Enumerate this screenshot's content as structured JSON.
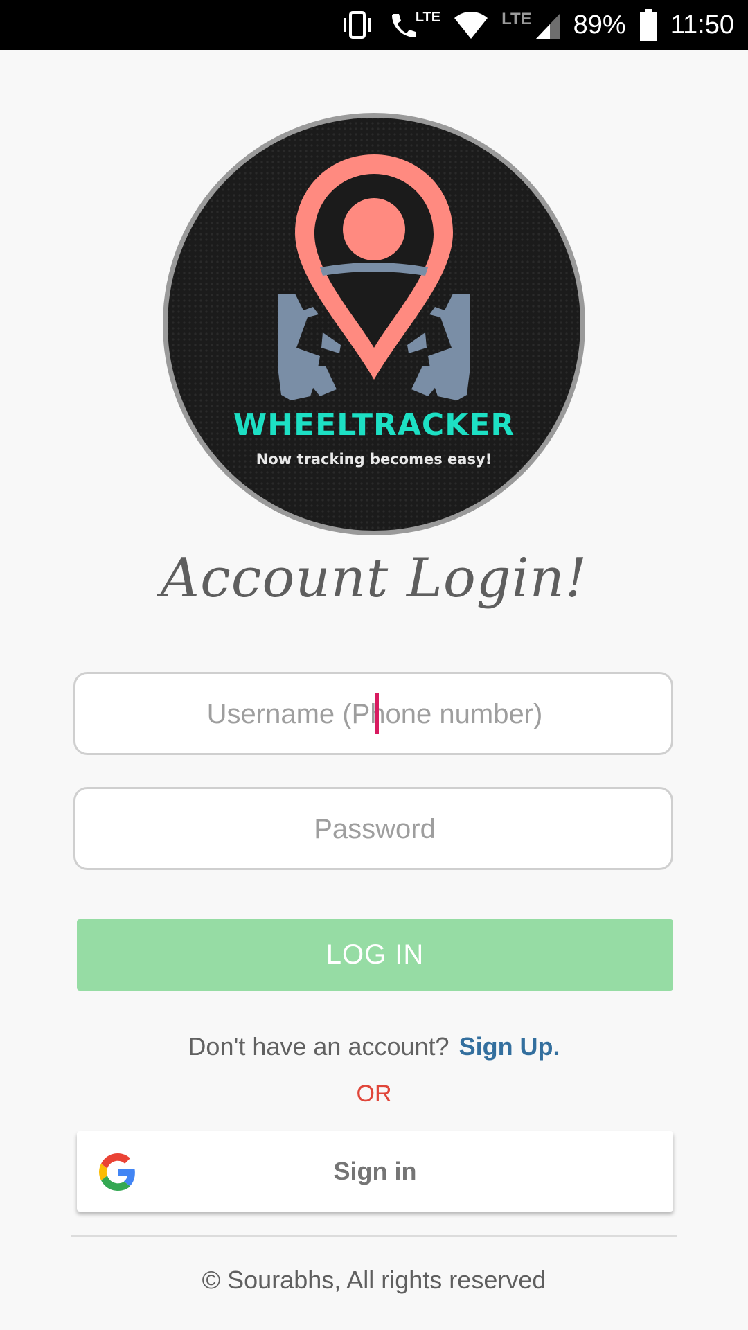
{
  "status_bar": {
    "lte_call": "LTE",
    "lte_signal": "LTE",
    "battery": "89%",
    "time": "11:50",
    "icons": [
      "vibrate-icon",
      "call-lte-icon",
      "wifi-icon",
      "signal-icon",
      "battery-icon"
    ]
  },
  "logo": {
    "brand": "WHEELTRACKER",
    "tagline": "Now tracking becomes easy!",
    "colors": {
      "pin": "#ff8a80",
      "car": "#7a8ea6",
      "brand_text": "#1de0c4",
      "background": "#1b1b1b"
    }
  },
  "page": {
    "title": "Account Login!"
  },
  "form": {
    "username_placeholder": "Username (Phone number)",
    "password_placeholder": "Password",
    "login_label": "LOG IN"
  },
  "signup": {
    "prompt": "Don't have an account?",
    "link": "Sign Up."
  },
  "or_label": "OR",
  "google": {
    "label": "Sign in",
    "icon": "google-g-icon"
  },
  "footer": {
    "text": "© Sourabhs, All rights reserved"
  }
}
